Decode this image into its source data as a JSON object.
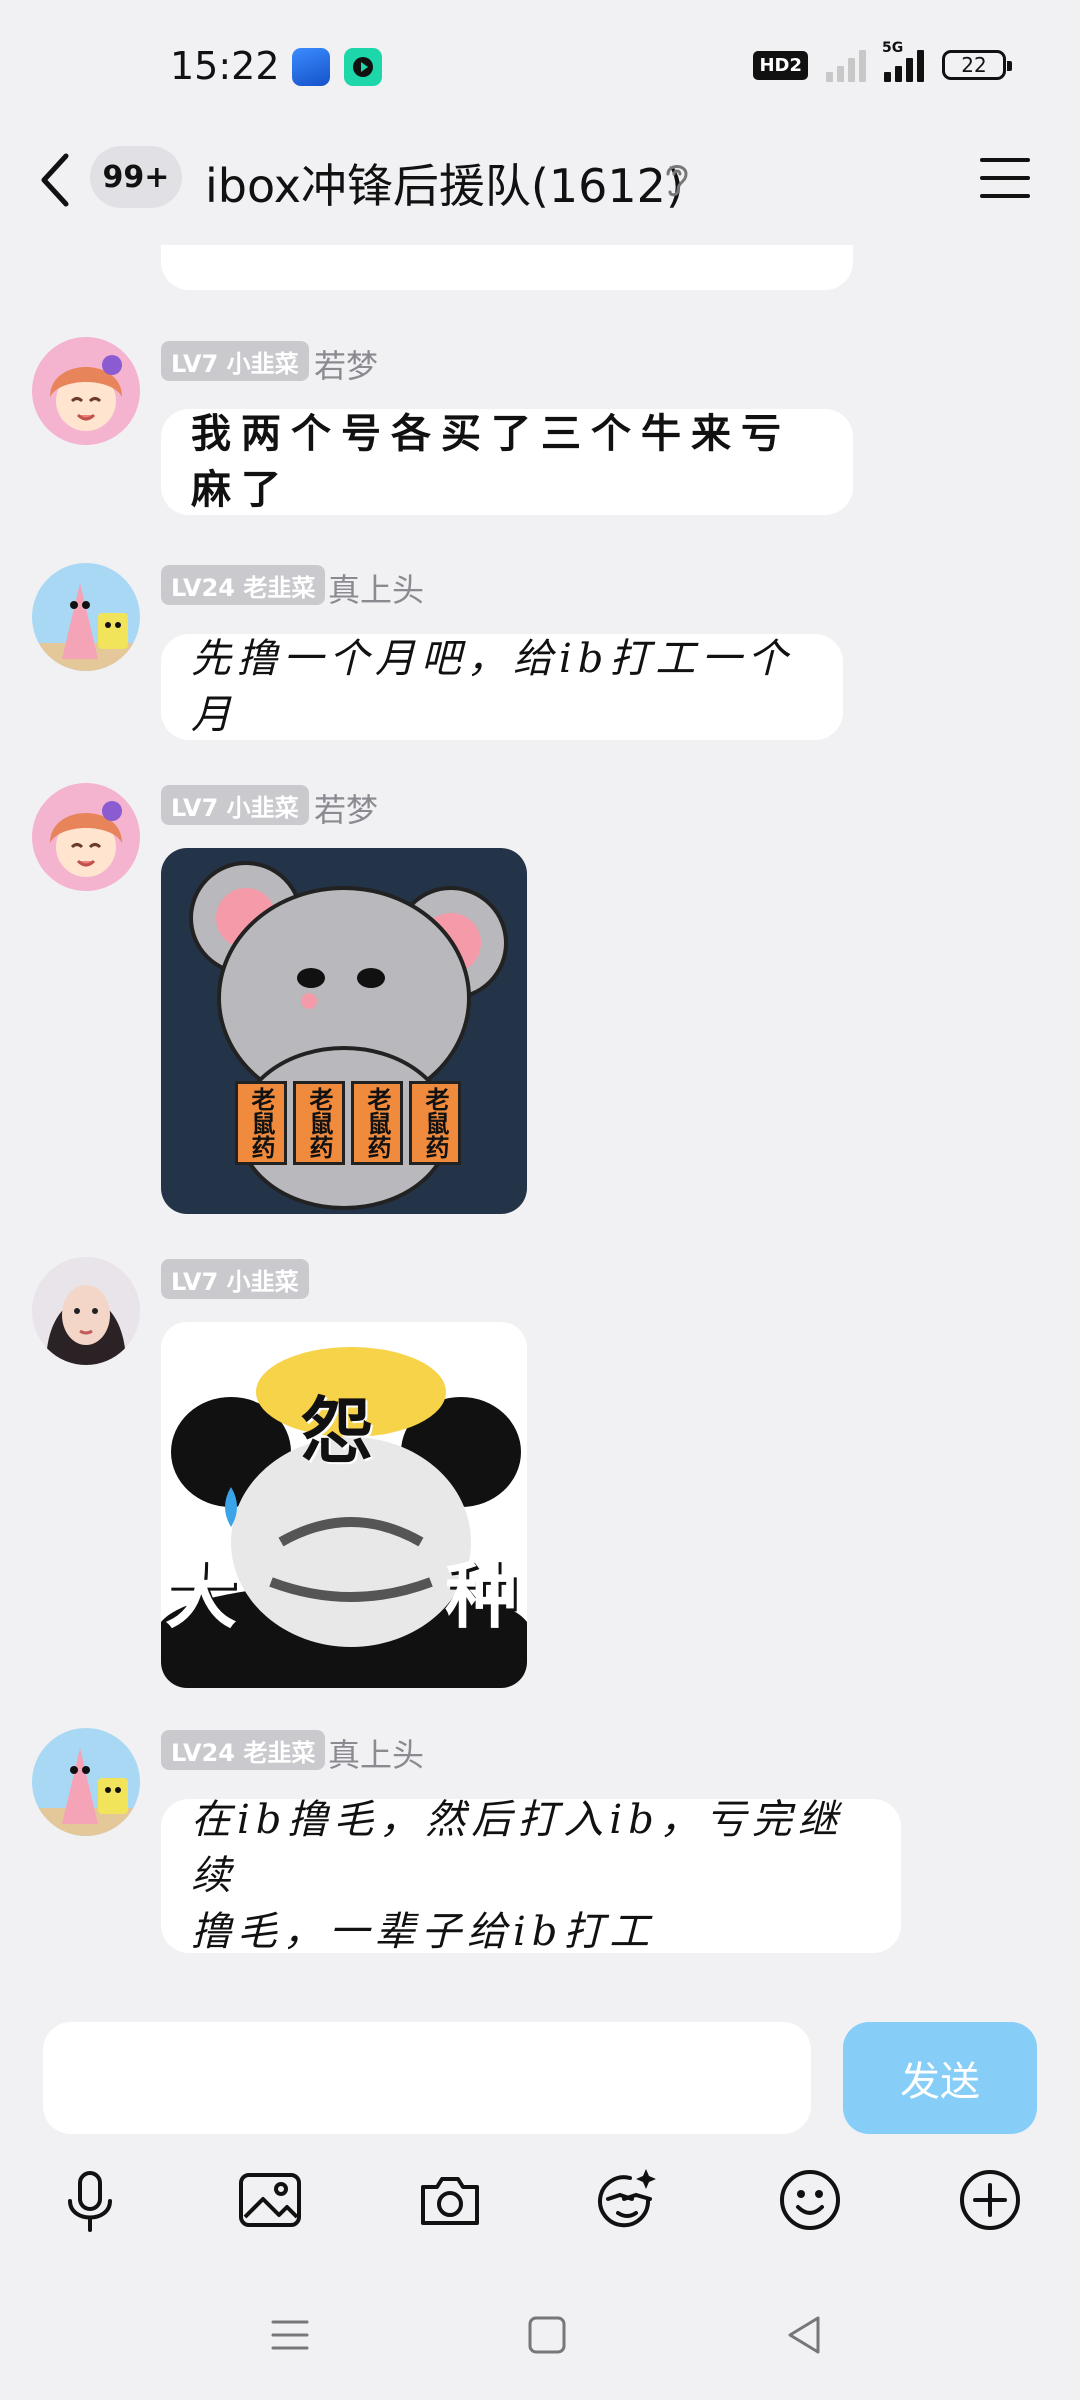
{
  "status_bar": {
    "time": "15:22",
    "hd_label": "HD2",
    "network_label": "5G",
    "battery_level": "22"
  },
  "header": {
    "unread_count": "99+",
    "group_name": "ibox冲锋后援队(1612)"
  },
  "messages": [
    {
      "type": "text",
      "level": "LV7 小韭菜",
      "nickname": "若梦",
      "avatar": "girl-anime-avatar",
      "text": "我两个号各买了三个牛来亏麻了"
    },
    {
      "type": "text",
      "level": "LV24 老韭菜",
      "nickname": "真上头",
      "avatar": "patrick-spongebob-avatar",
      "text": "先撸一个月吧，给ib打工一个月"
    },
    {
      "type": "sticker",
      "level": "LV7 小韭菜",
      "nickname": "若梦",
      "avatar": "girl-anime-avatar",
      "sticker_labels": [
        "老鼠药",
        "老鼠药",
        "老鼠药",
        "老鼠药"
      ]
    },
    {
      "type": "sticker",
      "level": "LV7 小韭菜",
      "nickname": "",
      "avatar": "woman-photo-avatar",
      "sticker_labels": [
        "怨",
        "大",
        "种"
      ]
    },
    {
      "type": "text",
      "level": "LV24 老韭菜",
      "nickname": "真上头",
      "avatar": "patrick-spongebob-avatar",
      "text_lines": [
        "在ib撸毛，然后打入ib，亏完继续",
        "撸毛，一辈子给ib打工"
      ]
    }
  ],
  "input": {
    "placeholder": "",
    "send_label": "发送"
  },
  "toolbar": [
    "microphone-icon",
    "image-icon",
    "camera-icon",
    "sticker-face-icon",
    "emoji-icon",
    "plus-icon"
  ],
  "colors": {
    "background": "#f1f1f4",
    "bubble": "#ffffff",
    "send_button": "#86cdf7",
    "level_badge": "#c9c9ce",
    "nickname": "#8a8a90"
  }
}
